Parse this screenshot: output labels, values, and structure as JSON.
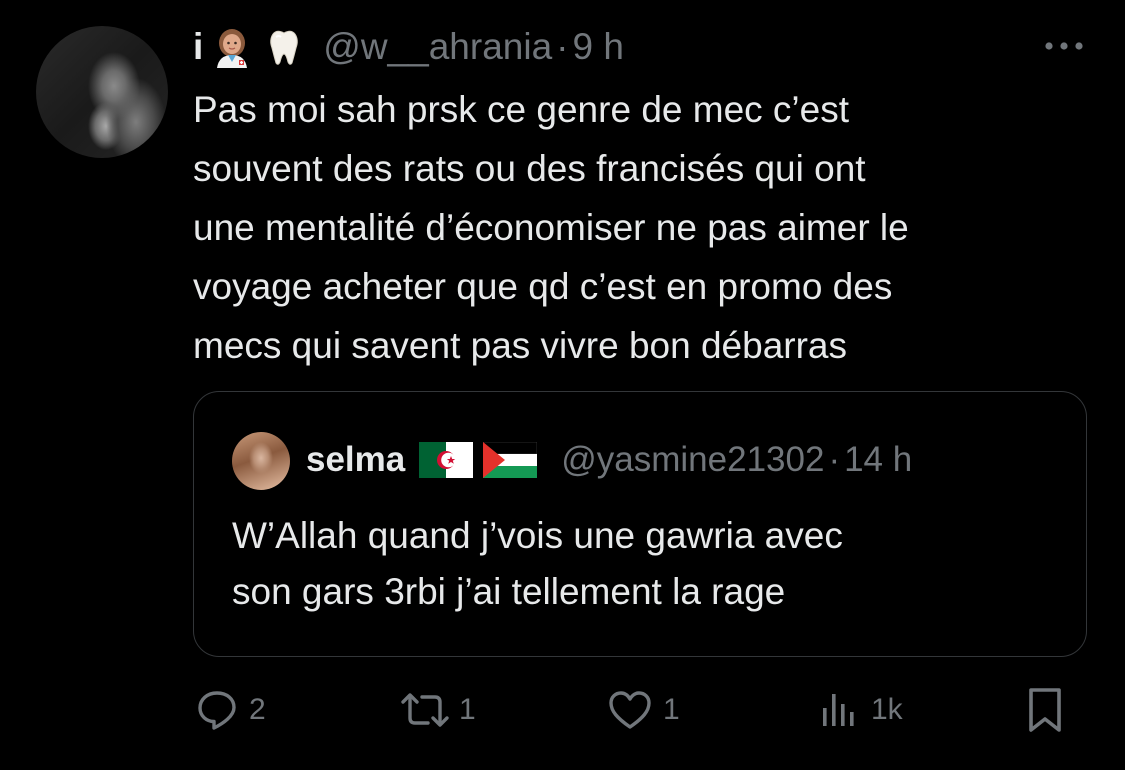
{
  "tweet": {
    "display_name": "i",
    "name_emojis": [
      "woman-health-worker-emoji",
      "tooth-emoji"
    ],
    "handle": "@w__ahrania",
    "separator": "·",
    "time": "9 h",
    "text": "Pas moi sah prsk ce genre de mec c’est\nsouvent des rats ou des francisés qui ont\nune mentalité d’économiser ne pas aimer le\nvoyage acheter que qd c’est en promo des\nmecs qui savent pas vivre bon débarras"
  },
  "quote": {
    "display_name": "selma",
    "flags": [
      "algeria-flag",
      "palestine-flag"
    ],
    "handle": "@yasmine21302",
    "separator": "·",
    "time": "14 h",
    "text": "W’Allah quand j’vois une gawria avec\nson gars 3rbi j’ai tellement la rage"
  },
  "actions": {
    "replies": "2",
    "reposts": "1",
    "likes": "1",
    "views": "1k"
  },
  "icons": {
    "more": "more-horizontal-icon",
    "reply": "reply-bubble-icon",
    "repost": "repost-icon",
    "like": "heart-icon",
    "views": "views-bar-chart-icon",
    "bookmark": "bookmark-icon"
  },
  "colors": {
    "background": "#000000",
    "text_primary": "#e7e9ea",
    "text_secondary": "#71767b",
    "border": "#333639"
  }
}
